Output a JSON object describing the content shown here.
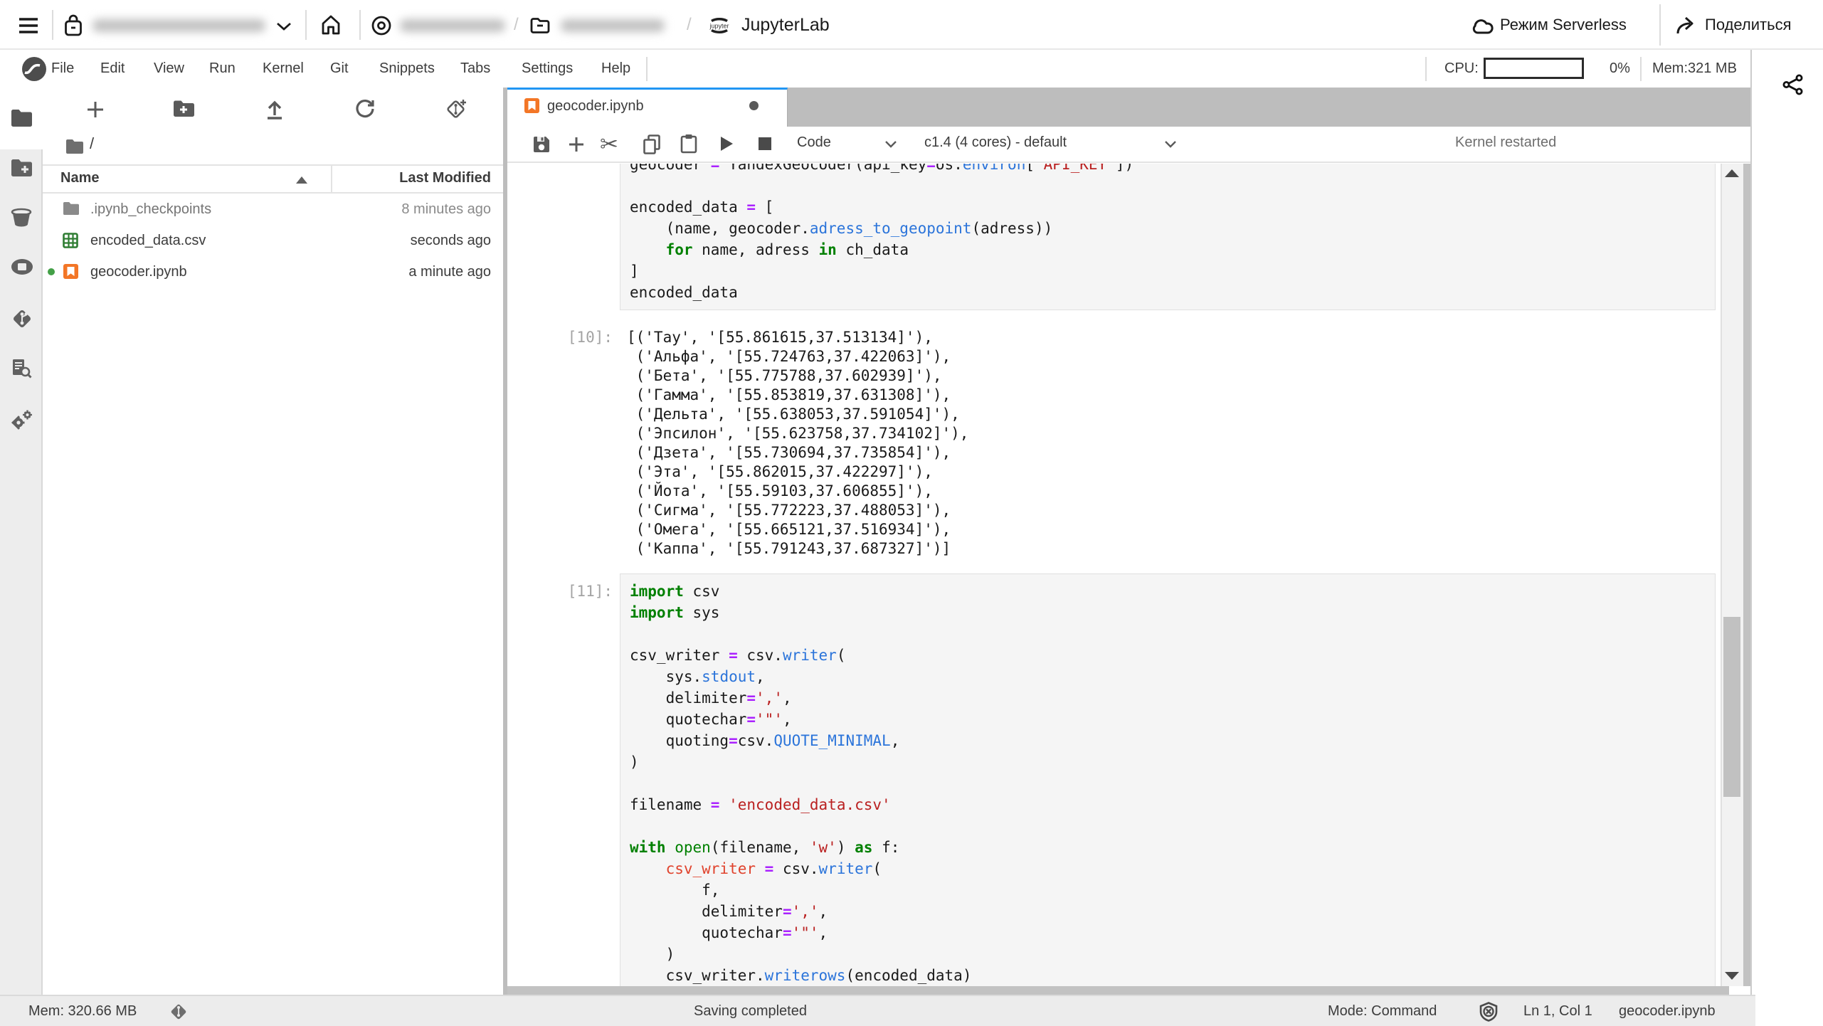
{
  "topbar": {
    "breadcrumb_separator": "/",
    "app_name": "JupyterLab",
    "serverless_label": "Режим Serverless",
    "share_label": "Поделиться",
    "jupyter_logo_text": "jupyter"
  },
  "menubar": {
    "items": [
      "File",
      "Edit",
      "View",
      "Run",
      "Kernel",
      "Git",
      "Snippets",
      "Tabs",
      "Settings",
      "Help"
    ],
    "cpu_label": "CPU:",
    "cpu_value": "0%",
    "mem_label": "Mem:321 MB"
  },
  "filebrowser": {
    "path": "/",
    "columns": {
      "name": "Name",
      "last_modified": "Last Modified"
    },
    "files": [
      {
        "name": ".ipynb_checkpoints",
        "modified": "8 minutes ago",
        "icon": "folder"
      },
      {
        "name": "encoded_data.csv",
        "modified": "seconds ago",
        "icon": "csv"
      },
      {
        "name": "geocoder.ipynb",
        "modified": "a minute ago",
        "icon": "notebook",
        "running": true
      }
    ]
  },
  "dock": {
    "tab_title": "geocoder.ipynb",
    "cell_type": "Code",
    "kernel_name": "c1.4 (4 cores) - default",
    "kernel_status": "Kernel restarted"
  },
  "notebook": {
    "cells": [
      {
        "kind": "code",
        "prompt": "",
        "lines": [
          [
            [
              "t",
              "geocoder "
            ],
            [
              "o",
              "="
            ],
            [
              "t",
              " YandexGeocoder(api_key"
            ],
            [
              "o",
              "="
            ],
            [
              "t",
              "os."
            ],
            [
              "p",
              "environ"
            ],
            [
              "t",
              "["
            ],
            [
              "s",
              "'API_KEY'"
            ],
            [
              "t",
              "])"
            ]
          ],
          [],
          [
            [
              "t",
              "encoded_data "
            ],
            [
              "o",
              "="
            ],
            [
              "t",
              " ["
            ]
          ],
          [
            [
              "t",
              "    (name, geocoder."
            ],
            [
              "p",
              "adress_to_geopoint"
            ],
            [
              "t",
              "(adress))"
            ]
          ],
          [
            [
              "t",
              "    "
            ],
            [
              "k",
              "for"
            ],
            [
              "t",
              " name, adress "
            ],
            [
              "k",
              "in"
            ],
            [
              "t",
              " ch_data"
            ]
          ],
          [
            [
              "t",
              "]"
            ]
          ],
          [
            [
              "t",
              "encoded_data"
            ]
          ]
        ]
      },
      {
        "kind": "output",
        "prompt": "[10]:",
        "lines": [
          [
            [
              "t",
              "[('Тау', '[55.861615,37.513134]'),"
            ]
          ],
          [
            [
              "t",
              " ('Альфа', '[55.724763,37.422063]'),"
            ]
          ],
          [
            [
              "t",
              " ('Бета', '[55.775788,37.602939]'),"
            ]
          ],
          [
            [
              "t",
              " ('Гамма', '[55.853819,37.631308]'),"
            ]
          ],
          [
            [
              "t",
              " ('Дельта', '[55.638053,37.591054]'),"
            ]
          ],
          [
            [
              "t",
              " ('Эпсилон', '[55.623758,37.734102]'),"
            ]
          ],
          [
            [
              "t",
              " ('Дзета', '[55.730694,37.735854]'),"
            ]
          ],
          [
            [
              "t",
              " ('Эта', '[55.862015,37.422297]'),"
            ]
          ],
          [
            [
              "t",
              " ('Йота', '[55.59103,37.606855]'),"
            ]
          ],
          [
            [
              "t",
              " ('Сигма', '[55.772223,37.488053]'),"
            ]
          ],
          [
            [
              "t",
              " ('Омега', '[55.665121,37.516934]'),"
            ]
          ],
          [
            [
              "t",
              " ('Каппа', '[55.791243,37.687327]')]"
            ]
          ]
        ]
      },
      {
        "kind": "code",
        "prompt": "[11]:",
        "lines": [
          [
            [
              "k",
              "import"
            ],
            [
              "t",
              " csv"
            ]
          ],
          [
            [
              "k",
              "import"
            ],
            [
              "t",
              " sys"
            ]
          ],
          [],
          [
            [
              "t",
              "csv_writer "
            ],
            [
              "o",
              "="
            ],
            [
              "t",
              " csv."
            ],
            [
              "p",
              "writer"
            ],
            [
              "t",
              "("
            ]
          ],
          [
            [
              "t",
              "    sys."
            ],
            [
              "p",
              "stdout"
            ],
            [
              "t",
              ","
            ]
          ],
          [
            [
              "t",
              "    delimiter"
            ],
            [
              "o",
              "="
            ],
            [
              "s",
              "','"
            ],
            [
              "t",
              ","
            ]
          ],
          [
            [
              "t",
              "    quotechar"
            ],
            [
              "o",
              "="
            ],
            [
              "s",
              "'\"'"
            ],
            [
              "t",
              ","
            ]
          ],
          [
            [
              "t",
              "    quoting"
            ],
            [
              "o",
              "="
            ],
            [
              "t",
              "csv."
            ],
            [
              "p",
              "QUOTE_MINIMAL"
            ],
            [
              "t",
              ","
            ]
          ],
          [
            [
              "t",
              ")"
            ]
          ],
          [],
          [
            [
              "t",
              "filename "
            ],
            [
              "o",
              "="
            ],
            [
              "t",
              " "
            ],
            [
              "s",
              "'encoded_data.csv'"
            ]
          ],
          [],
          [
            [
              "k",
              "with"
            ],
            [
              "t",
              " "
            ],
            [
              "b",
              "open"
            ],
            [
              "t",
              "(filename, "
            ],
            [
              "s",
              "'w'"
            ],
            [
              "t",
              ") "
            ],
            [
              "k",
              "as"
            ],
            [
              "t",
              " f:"
            ]
          ],
          [
            [
              "t",
              "    "
            ],
            [
              "r",
              "csv_writer"
            ],
            [
              "t",
              " "
            ],
            [
              "o",
              "="
            ],
            [
              "t",
              " csv."
            ],
            [
              "p",
              "writer"
            ],
            [
              "t",
              "("
            ]
          ],
          [
            [
              "t",
              "        f,"
            ]
          ],
          [
            [
              "t",
              "        delimiter"
            ],
            [
              "o",
              "="
            ],
            [
              "s",
              "','"
            ],
            [
              "t",
              ","
            ]
          ],
          [
            [
              "t",
              "        quotechar"
            ],
            [
              "o",
              "="
            ],
            [
              "s",
              "'\"'"
            ],
            [
              "t",
              ","
            ]
          ],
          [
            [
              "t",
              "    )"
            ]
          ],
          [
            [
              "t",
              "    csv_writer."
            ],
            [
              "p",
              "writerows"
            ],
            [
              "t",
              "(encoded_data)"
            ]
          ]
        ]
      }
    ]
  },
  "statusbar": {
    "mem": "Mem: 320.66 MB",
    "message": "Saving completed",
    "mode": "Mode: Command",
    "position": "Ln 1, Col 1",
    "file": "geocoder.ipynb"
  }
}
